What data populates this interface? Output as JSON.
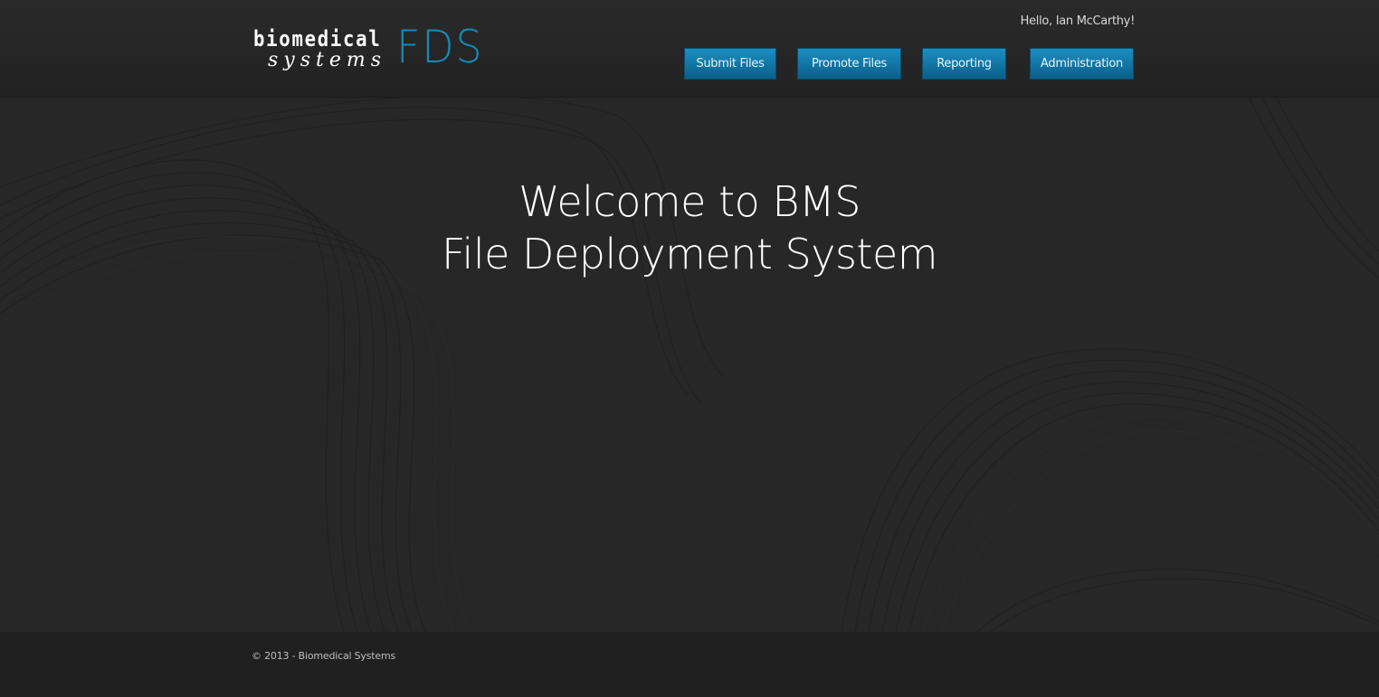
{
  "header": {
    "logo": {
      "line1": "biomedical",
      "line2": "systems",
      "product": "FDS"
    },
    "greeting": "Hello, Ian McCarthy!",
    "nav": [
      {
        "label": "Submit Files"
      },
      {
        "label": "Promote Files"
      },
      {
        "label": "Reporting"
      },
      {
        "label": "Administration"
      }
    ]
  },
  "main": {
    "title_line1": "Welcome to BMS",
    "title_line2": "File Deployment System"
  },
  "footer": {
    "copyright": "© 2013 - Biomedical Systems"
  },
  "colors": {
    "accent": "#1689b8",
    "button_top": "#1c8ec2",
    "button_bottom": "#0a5f88",
    "background": "#272727",
    "footer_bg": "#202020"
  }
}
